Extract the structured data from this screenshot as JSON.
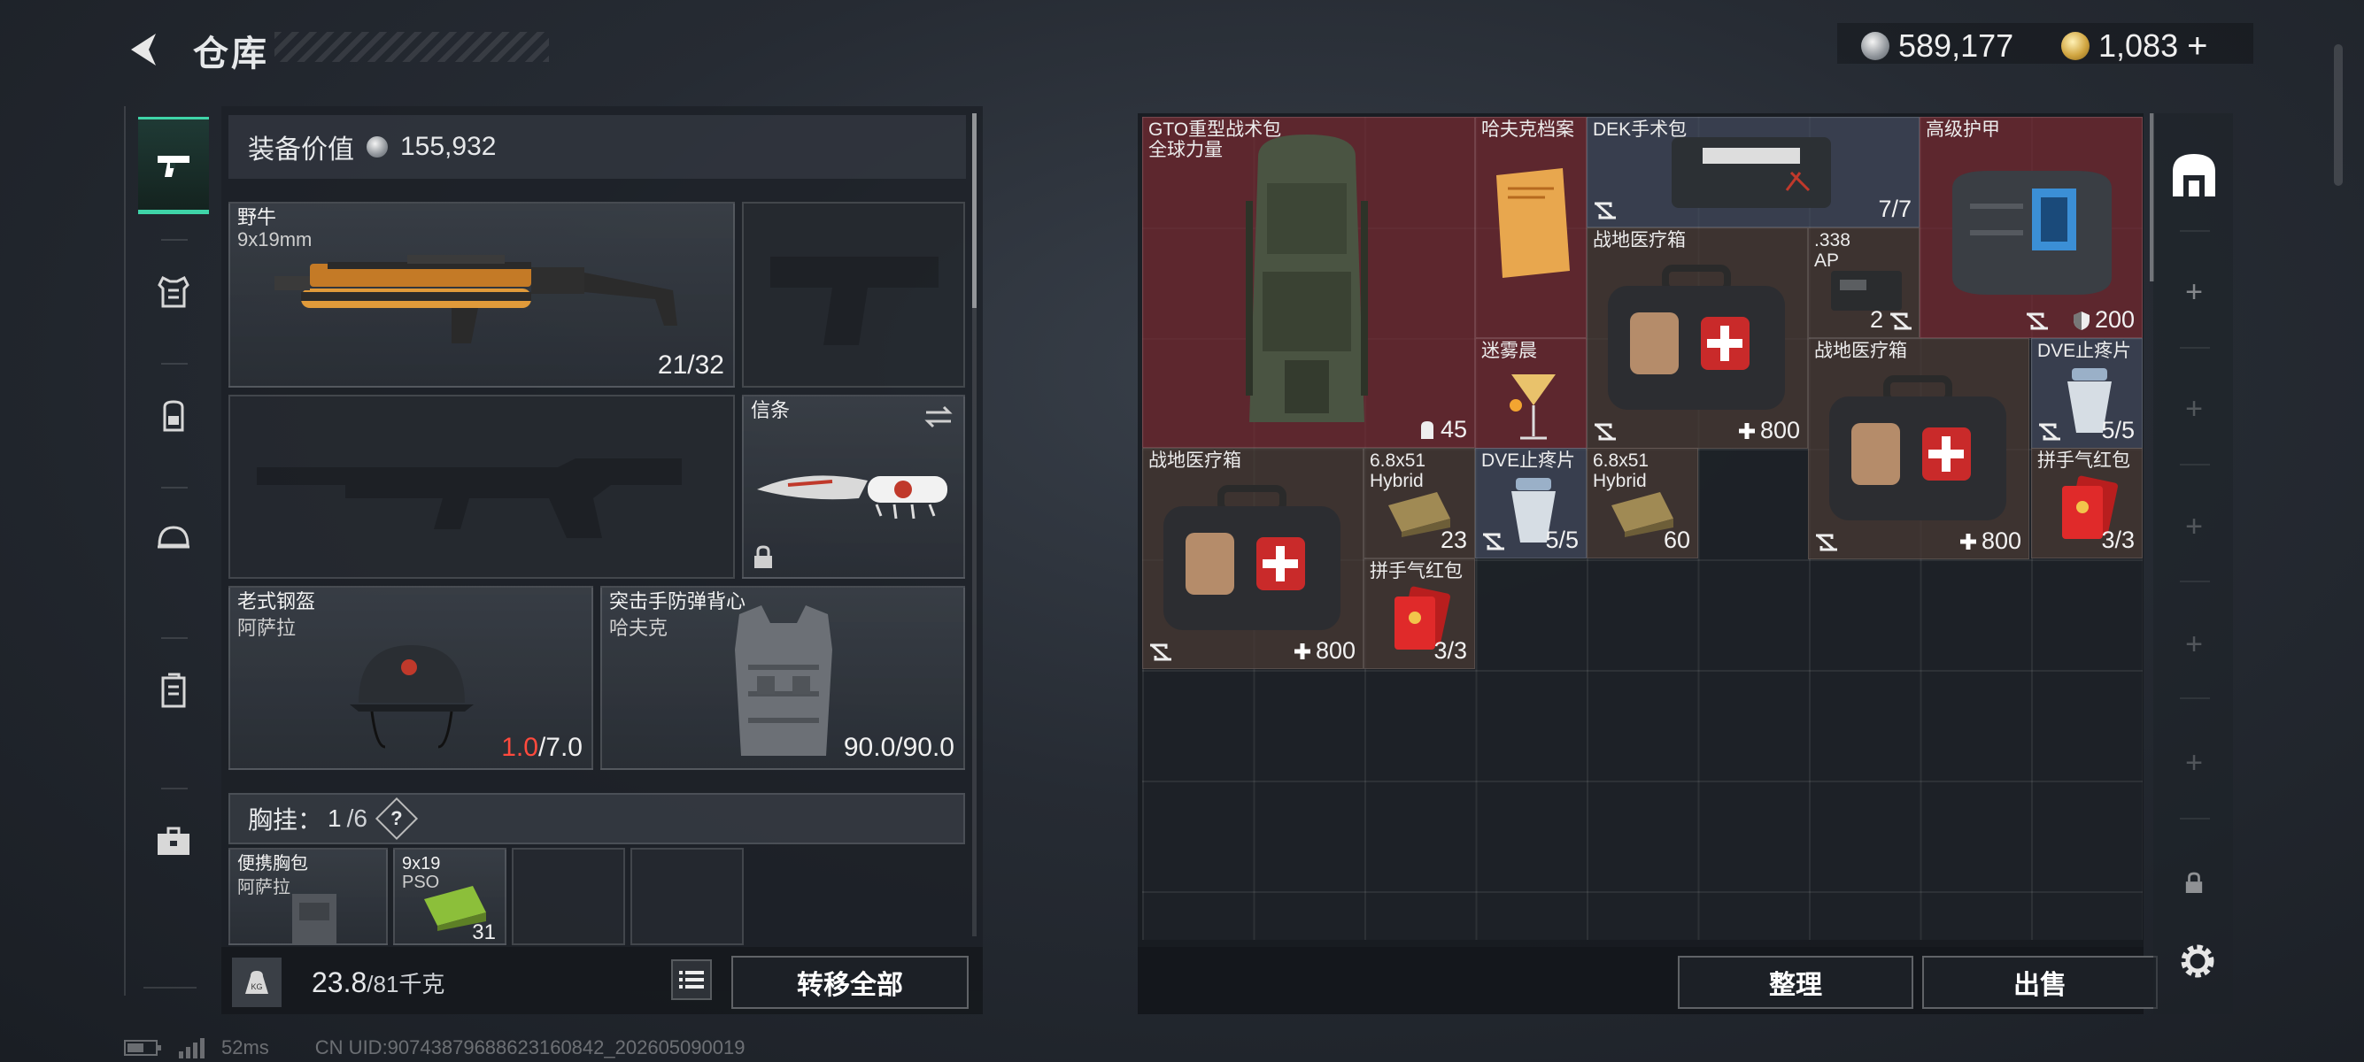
{
  "header": {
    "title": "仓库",
    "currency_silver": "589,177",
    "currency_gold": "1,083",
    "add_label": "+"
  },
  "equipment": {
    "value_label": "装备价值",
    "value": "155,932",
    "primary": {
      "name": "野牛",
      "caliber": "9x19mm",
      "ammo": "21/32"
    },
    "melee": {
      "name": "信条"
    },
    "helmet": {
      "name": "老式钢盔",
      "brand": "阿萨拉",
      "durability_current": "1.0",
      "durability_max": "/7.0"
    },
    "vest": {
      "name": "突击手防弹背心",
      "brand": "哈夫克",
      "durability": "90.0/90.0"
    },
    "rig": {
      "label": "胸挂：",
      "used": "1",
      "capacity": "/6",
      "help": "?"
    },
    "rig_items": [
      {
        "name": "便携胸包",
        "brand": "阿萨拉"
      },
      {
        "name": "9x19",
        "sub": "PSO",
        "count": "31"
      }
    ],
    "weight": "23.8",
    "weight_max": "/81千克",
    "transfer_all": "转移全部"
  },
  "storage": {
    "items": [
      {
        "name": "GTO重型战术包",
        "sub": "全球力量",
        "count": "45"
      },
      {
        "name": "哈夫克档案"
      },
      {
        "name": "DEK手术包",
        "count": "7/7"
      },
      {
        "name": "高级护甲",
        "count": "200"
      },
      {
        "name": "战地医疗箱",
        "count": "800"
      },
      {
        "name": ".338",
        "sub": "AP",
        "count": "2"
      },
      {
        "name": "迷雾晨"
      },
      {
        "name": "战地医疗箱",
        "count": "800"
      },
      {
        "name": "DVE止疼片",
        "count": "5/5"
      },
      {
        "name": "战地医疗箱",
        "count": "800"
      },
      {
        "name": "6.8x51",
        "sub": "Hybrid",
        "count": "23"
      },
      {
        "name": "DVE止疼片",
        "count": "5/5"
      },
      {
        "name": "6.8x51",
        "sub": "Hybrid",
        "count": "60"
      },
      {
        "name": "拼手气红包",
        "count": "3/3"
      },
      {
        "name": "拼手气红包",
        "count": "3/3"
      }
    ],
    "sort_label": "整理",
    "sell_label": "出售"
  },
  "status": {
    "ping": "52ms",
    "uid": "CN UID:90743879688623160842_202605090019"
  },
  "colors": {
    "accent": "#3fd4a8",
    "rare_red": "#762a32",
    "durability_low": "#ff4a3d"
  },
  "icons": [
    "back-arrow-icon",
    "pistol-icon",
    "armor-icon",
    "backpack-icon",
    "helmet-icon",
    "case-icon",
    "toolbox-icon",
    "stash-icon",
    "plus-icon",
    "lock-icon",
    "gear-icon",
    "weight-icon",
    "list-icon",
    "swap-icon",
    "bind-icon",
    "armor-shield-icon",
    "cross-plus-icon",
    "capacity-icon"
  ]
}
